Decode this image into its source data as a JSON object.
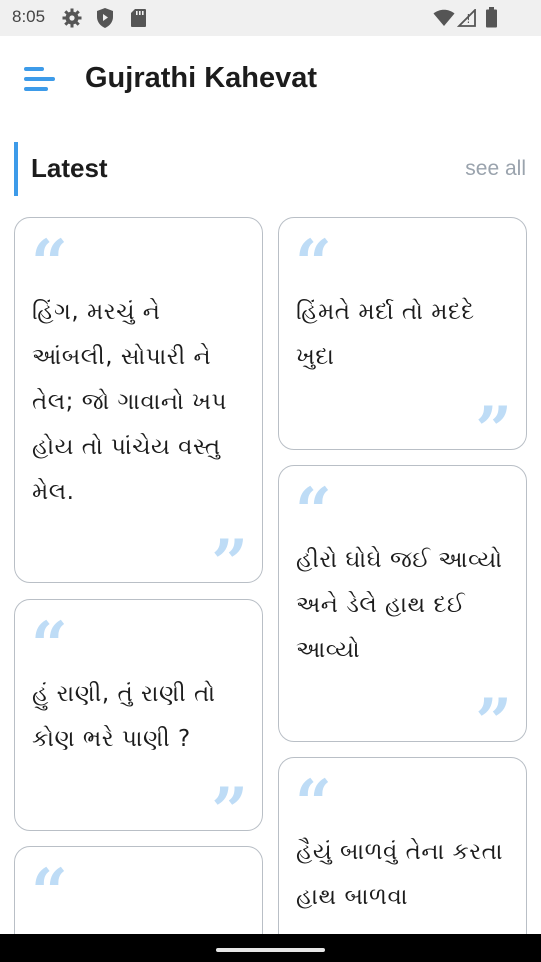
{
  "status_bar": {
    "time": "8:05",
    "icons": [
      "gear-icon",
      "shield-icon",
      "sd-card-icon",
      "wifi-icon",
      "signal-icon",
      "battery-icon"
    ]
  },
  "app_bar": {
    "menu_icon": "menu-icon",
    "title": "Gujrathi Kahevat"
  },
  "section": {
    "title": "Latest",
    "see_all": "see all",
    "accent_color": "#3d9be9"
  },
  "quotes": {
    "left": [
      {
        "text": "હિંગ, મરચું ને આંબલી, સોપારી ને તેલ; જો ગાવાનો ખપ હોય તો પાંચેય વસ્તુ મેલ."
      },
      {
        "text": "હું રાણી, તું રાણી તો કોણ ભરે પાણી ?"
      },
      {
        "text": ""
      }
    ],
    "right": [
      {
        "text": "હિંમતે મર્દા તો મદદે ખુદા"
      },
      {
        "text": "હીરો ઘોઘે જઈ આવ્યો અને ડેલે હાથ દઈ આવ્યો"
      },
      {
        "text": "હૈયું બાળવું તેના કરતા હાથ બાળવા"
      }
    ]
  },
  "quote_marks": {
    "open": "“",
    "close": "”",
    "color": "#bedcf6"
  }
}
